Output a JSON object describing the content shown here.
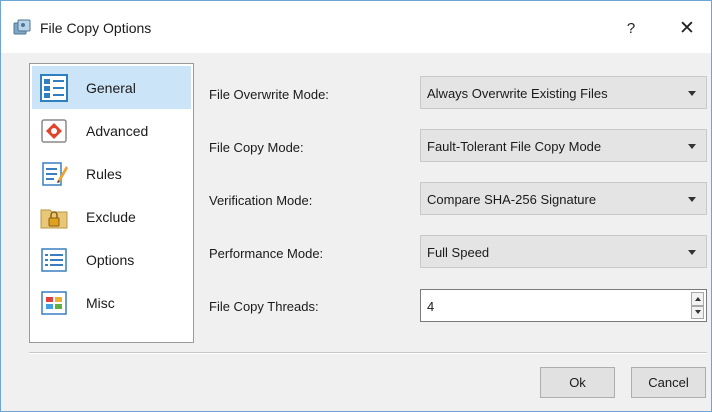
{
  "window": {
    "title": "File Copy Options",
    "help_label": "?",
    "close_label": "✕"
  },
  "sidebar": {
    "items": [
      {
        "label": "General",
        "icon": "general-icon",
        "selected": true
      },
      {
        "label": "Advanced",
        "icon": "advanced-icon",
        "selected": false
      },
      {
        "label": "Rules",
        "icon": "rules-icon",
        "selected": false
      },
      {
        "label": "Exclude",
        "icon": "exclude-lock-icon",
        "selected": false
      },
      {
        "label": "Options",
        "icon": "options-list-icon",
        "selected": false
      },
      {
        "label": "Misc",
        "icon": "misc-tiles-icon",
        "selected": false
      }
    ]
  },
  "form": {
    "overwrite_label": "File Overwrite Mode:",
    "overwrite_value": "Always Overwrite Existing Files",
    "copy_mode_label": "File Copy Mode:",
    "copy_mode_value": "Fault-Tolerant File Copy Mode",
    "verification_label": "Verification Mode:",
    "verification_value": "Compare SHA-256 Signature",
    "performance_label": "Performance Mode:",
    "performance_value": "Full Speed",
    "threads_label": "File Copy Threads:",
    "threads_value": "4"
  },
  "buttons": {
    "ok": "Ok",
    "cancel": "Cancel"
  },
  "colors": {
    "selected_bg": "#cce4f7",
    "window_border": "#6fa4d6"
  }
}
